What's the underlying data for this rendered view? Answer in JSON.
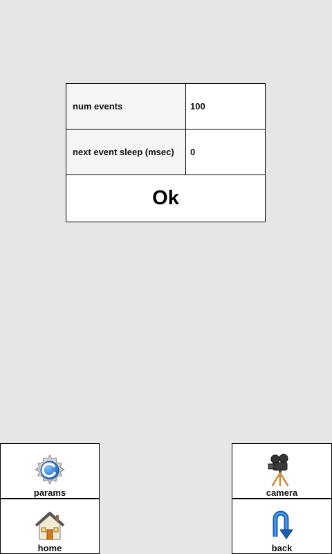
{
  "dialog": {
    "rows": [
      {
        "label": "num events",
        "value": "100"
      },
      {
        "label": "next event sleep (msec)",
        "value": "0"
      }
    ],
    "ok_label": "Ok"
  },
  "nav": {
    "params": {
      "label": "params",
      "icon": "gear-icon"
    },
    "camera": {
      "label": "camera",
      "icon": "movie-camera-icon"
    },
    "home": {
      "label": "home",
      "icon": "house-icon"
    },
    "back": {
      "label": "back",
      "icon": "back-arrow-icon"
    }
  },
  "colors": {
    "background": "#e6e6e6",
    "label_cell": "#f5f5f5",
    "back_arrow": "#1a5fb4",
    "gear_accent": "#2a7fd4"
  }
}
